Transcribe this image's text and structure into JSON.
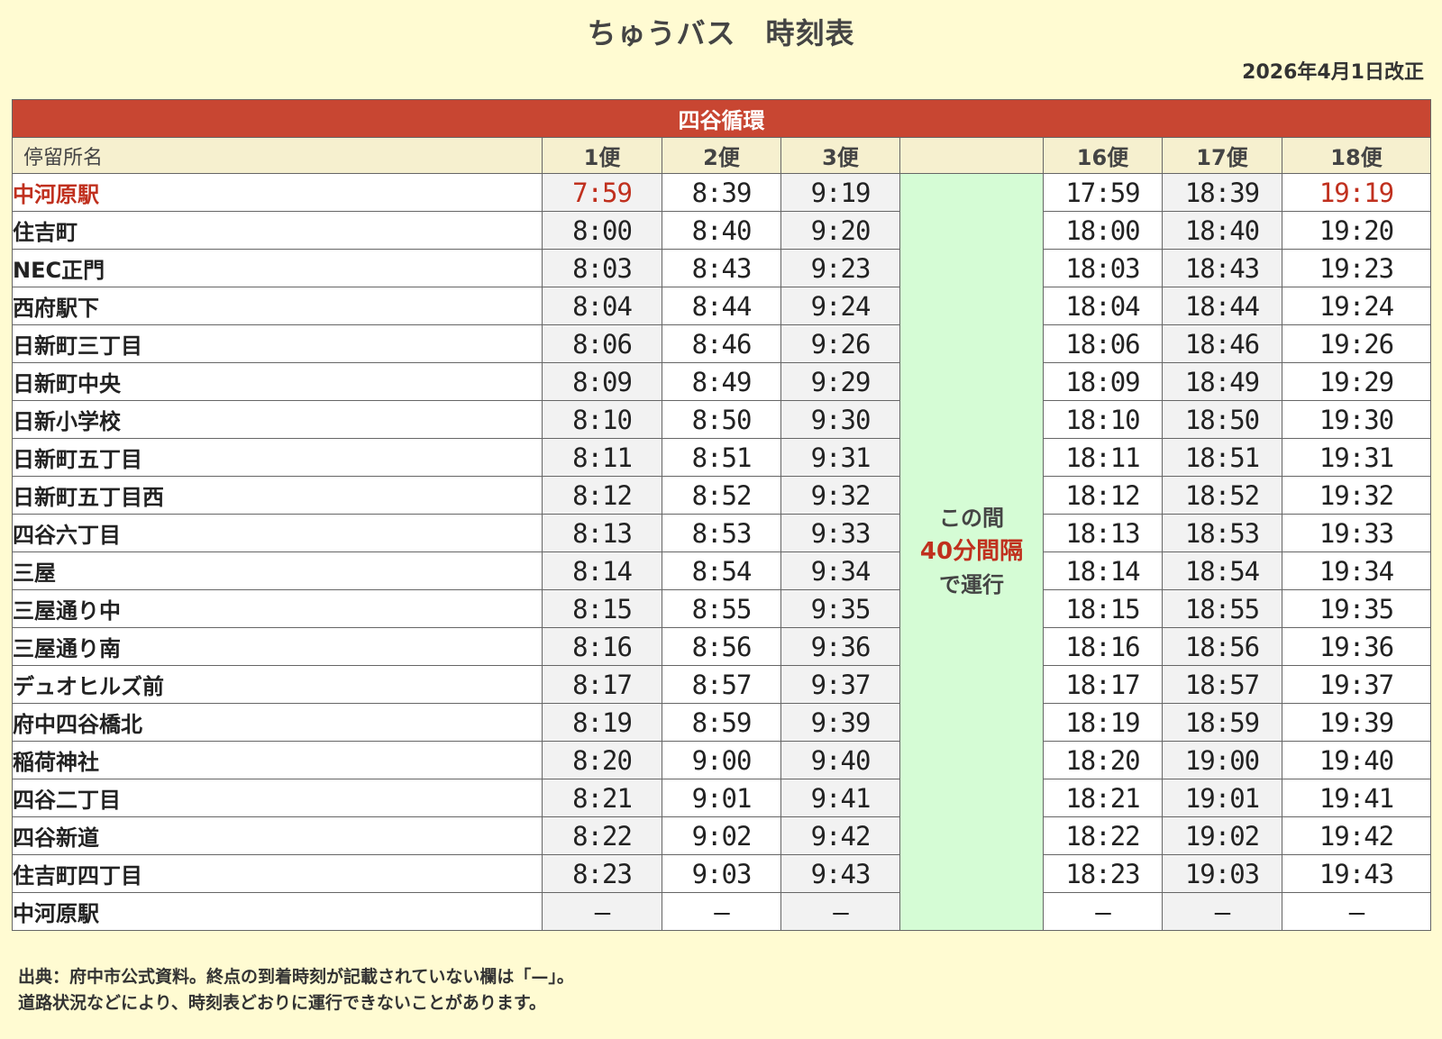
{
  "title": "ちゅうバス　時刻表",
  "revised": "2026年4月1日改正",
  "route_name": "四谷循環",
  "stop_header": "停留所名",
  "trip_headers": [
    "1便",
    "2便",
    "3便",
    "16便",
    "17便",
    "18便"
  ],
  "gap_note": {
    "line1": "この間",
    "line2": "40分間隔",
    "line3": "で運行"
  },
  "stops": [
    {
      "name": "中河原駅",
      "highlight": true,
      "times": [
        "7:59",
        "8:39",
        "9:19",
        "17:59",
        "18:39",
        "19:19"
      ]
    },
    {
      "name": "住吉町",
      "times": [
        "8:00",
        "8:40",
        "9:20",
        "18:00",
        "18:40",
        "19:20"
      ]
    },
    {
      "name": "NEC正門",
      "times": [
        "8:03",
        "8:43",
        "9:23",
        "18:03",
        "18:43",
        "19:23"
      ]
    },
    {
      "name": "西府駅下",
      "times": [
        "8:04",
        "8:44",
        "9:24",
        "18:04",
        "18:44",
        "19:24"
      ]
    },
    {
      "name": "日新町三丁目",
      "times": [
        "8:06",
        "8:46",
        "9:26",
        "18:06",
        "18:46",
        "19:26"
      ]
    },
    {
      "name": "日新町中央",
      "times": [
        "8:09",
        "8:49",
        "9:29",
        "18:09",
        "18:49",
        "19:29"
      ]
    },
    {
      "name": "日新小学校",
      "times": [
        "8:10",
        "8:50",
        "9:30",
        "18:10",
        "18:50",
        "19:30"
      ]
    },
    {
      "name": "日新町五丁目",
      "times": [
        "8:11",
        "8:51",
        "9:31",
        "18:11",
        "18:51",
        "19:31"
      ]
    },
    {
      "name": "日新町五丁目西",
      "times": [
        "8:12",
        "8:52",
        "9:32",
        "18:12",
        "18:52",
        "19:32"
      ]
    },
    {
      "name": "四谷六丁目",
      "times": [
        "8:13",
        "8:53",
        "9:33",
        "18:13",
        "18:53",
        "19:33"
      ]
    },
    {
      "name": "三屋",
      "times": [
        "8:14",
        "8:54",
        "9:34",
        "18:14",
        "18:54",
        "19:34"
      ]
    },
    {
      "name": "三屋通り中",
      "times": [
        "8:15",
        "8:55",
        "9:35",
        "18:15",
        "18:55",
        "19:35"
      ]
    },
    {
      "name": "三屋通り南",
      "times": [
        "8:16",
        "8:56",
        "9:36",
        "18:16",
        "18:56",
        "19:36"
      ]
    },
    {
      "name": "デュオヒルズ前",
      "times": [
        "8:17",
        "8:57",
        "9:37",
        "18:17",
        "18:57",
        "19:37"
      ]
    },
    {
      "name": "府中四谷橋北",
      "times": [
        "8:19",
        "8:59",
        "9:39",
        "18:19",
        "18:59",
        "19:39"
      ]
    },
    {
      "name": "稲荷神社",
      "times": [
        "8:20",
        "9:00",
        "9:40",
        "18:20",
        "19:00",
        "19:40"
      ]
    },
    {
      "name": "四谷二丁目",
      "times": [
        "8:21",
        "9:01",
        "9:41",
        "18:21",
        "19:01",
        "19:41"
      ]
    },
    {
      "name": "四谷新道",
      "times": [
        "8:22",
        "9:02",
        "9:42",
        "18:22",
        "19:02",
        "19:42"
      ]
    },
    {
      "name": "住吉町四丁目",
      "times": [
        "8:23",
        "9:03",
        "9:43",
        "18:23",
        "19:03",
        "19:43"
      ]
    },
    {
      "name": "中河原駅",
      "times": [
        "–",
        "–",
        "–",
        "–",
        "–",
        "–"
      ]
    }
  ],
  "notes": [
    "出典：府中市公式資料。終点の到着時刻が記載されていない欄は「—」。",
    "道路状況などにより、時刻表どおりに運行できないことがあります。"
  ],
  "colors": {
    "background": "#fffbd2",
    "route_header": "#c84632",
    "gap_column": "#d5fcd5",
    "highlight_text": "#c0301e"
  }
}
